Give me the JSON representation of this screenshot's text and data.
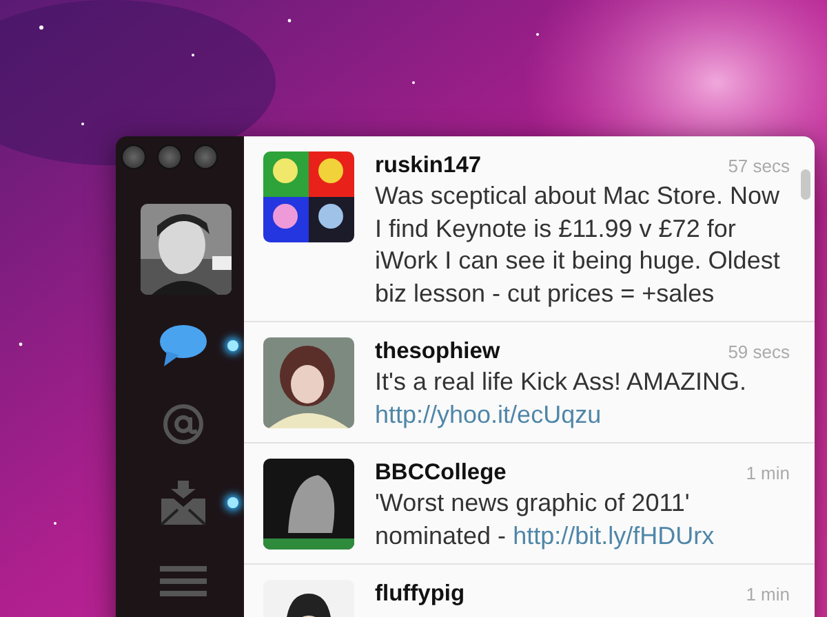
{
  "sidebar": {
    "items": [
      {
        "kind": "messages",
        "selected": true,
        "unread": true
      },
      {
        "kind": "mentions",
        "selected": false,
        "unread": false
      },
      {
        "kind": "inbox",
        "selected": false,
        "unread": true
      },
      {
        "kind": "menu",
        "selected": false,
        "unread": false
      }
    ]
  },
  "tweets": [
    {
      "user": "ruskin147",
      "time": "57 secs",
      "text": "Was sceptical about Mac Store. Now I find Keynote is £11.99 v £72 for iWork I can see it being huge. Oldest biz lesson - cut prices = +sales"
    },
    {
      "user": "thesophiew",
      "time": "59 secs",
      "text": "It's a real life Kick Ass! AMAZING.",
      "link": "http://yhoo.it/ecUqzu"
    },
    {
      "user": "BBCCollege",
      "time": "1 min",
      "text": "'Worst news graphic of 2011' nominated - ",
      "link": "http://bit.ly/fHDUrx"
    },
    {
      "user": "fluffypig",
      "time": "1 min"
    }
  ]
}
